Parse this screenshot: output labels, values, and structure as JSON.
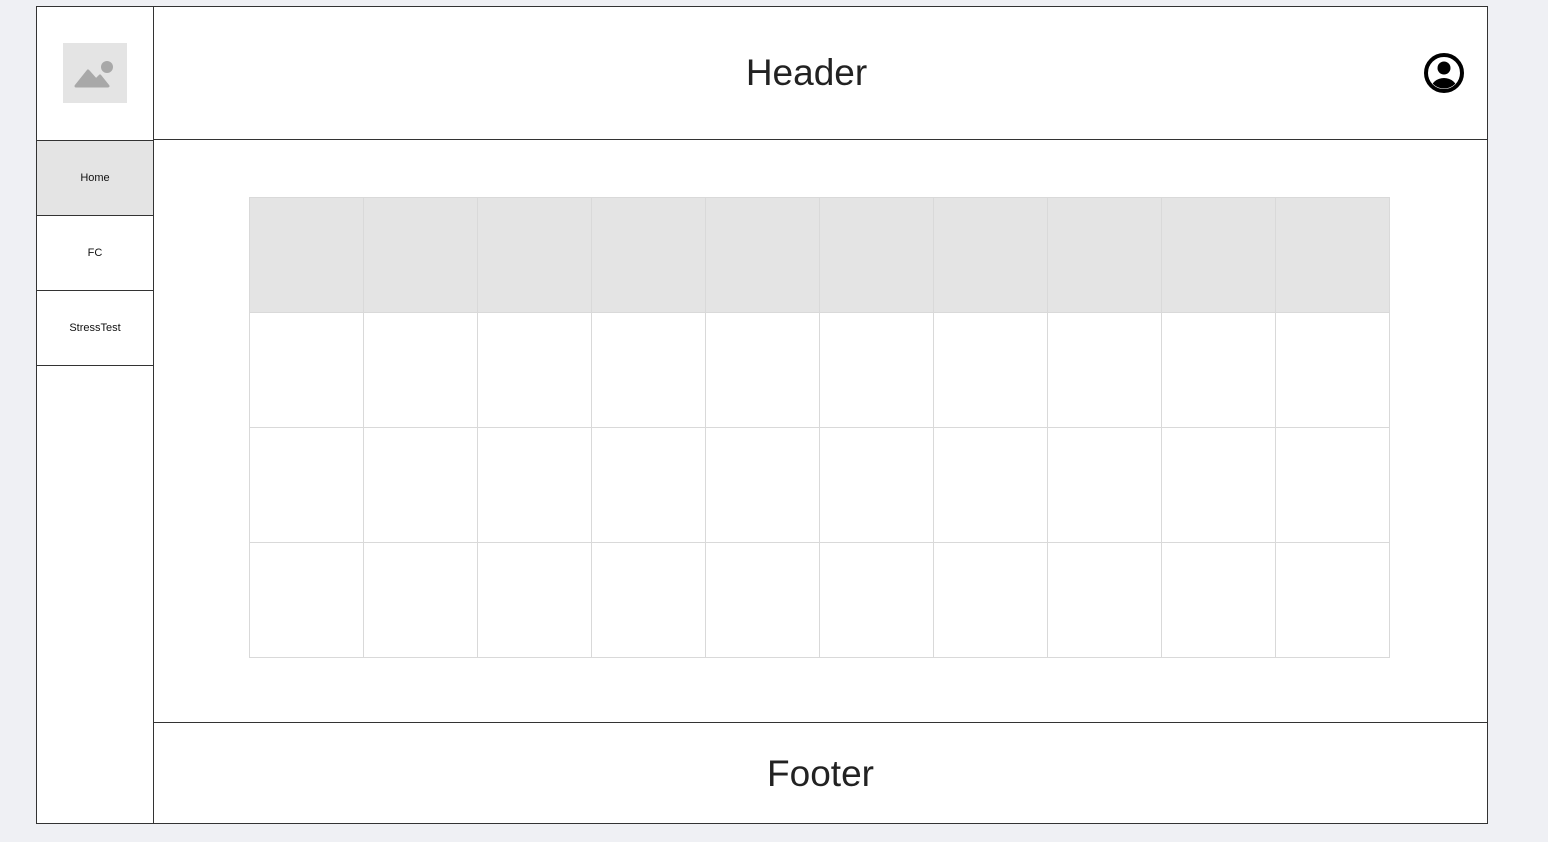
{
  "sidebar": {
    "logo_icon": "image-placeholder-icon",
    "items": [
      {
        "label": "Home",
        "active": true
      },
      {
        "label": "FC",
        "active": false
      },
      {
        "label": "StressTest",
        "active": false
      }
    ]
  },
  "header": {
    "title": "Header",
    "user_icon": "user-circle-icon"
  },
  "table": {
    "columns": 10,
    "rows": 4,
    "header_rows": 1,
    "header_color": "#e4e4e4"
  },
  "footer": {
    "text": "Footer"
  },
  "colors": {
    "background": "#eff0f4",
    "active_nav": "#e4e4e4",
    "border": "#333333",
    "grid_line": "#d9d9d9"
  }
}
